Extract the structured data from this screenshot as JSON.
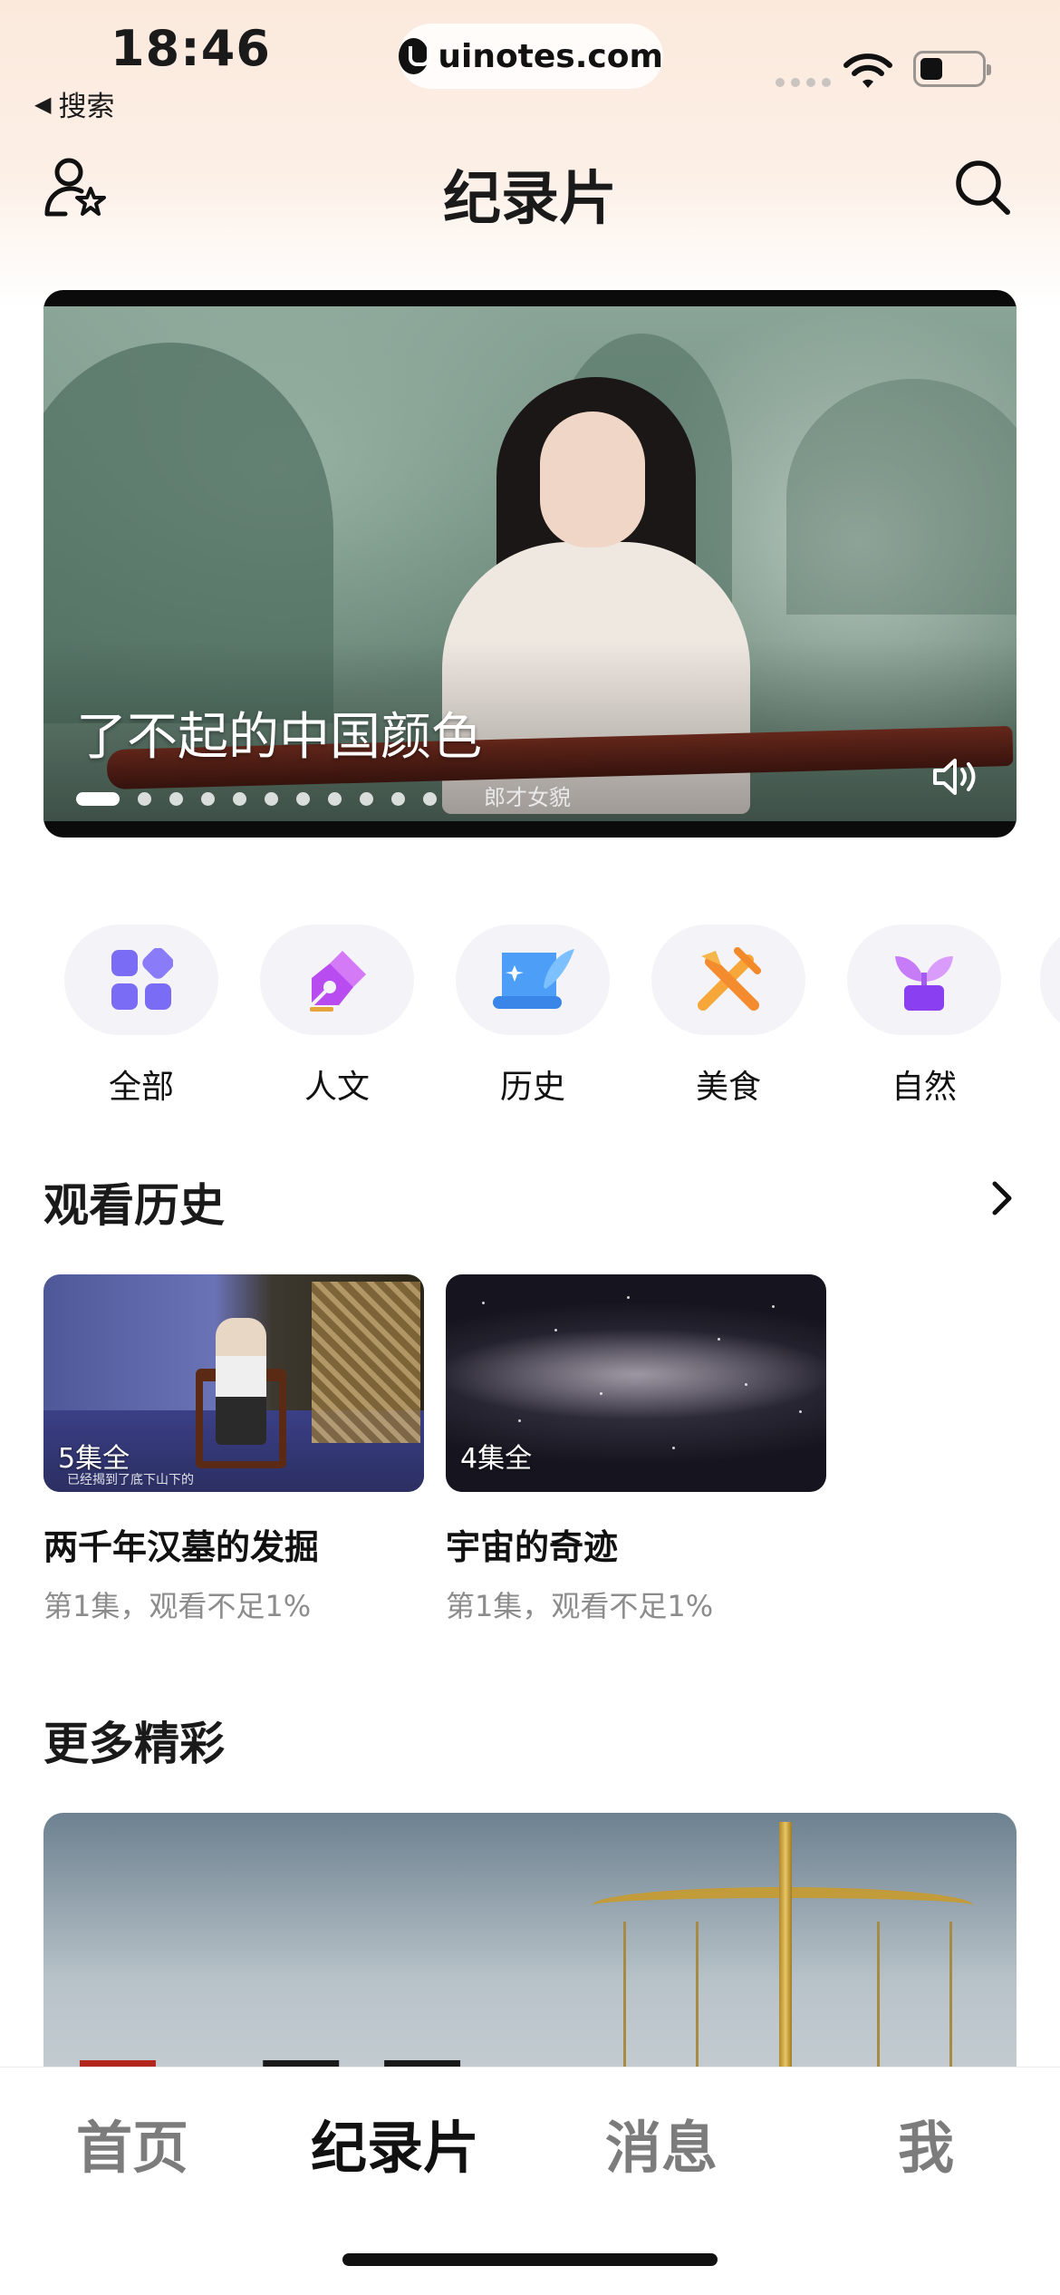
{
  "status_bar": {
    "time": "18:46",
    "back_label": "搜索",
    "back_icon": "triangle-left",
    "url": "uinotes.com"
  },
  "header": {
    "title": "纪录片",
    "left_icon": "profile-star-icon",
    "right_icon": "search-icon"
  },
  "banner": {
    "title": "了不起的中国颜色",
    "subtitle": "郎才女貌",
    "slide_count": 11,
    "active_slide": 0,
    "sound_icon": "speaker-icon"
  },
  "categories": [
    {
      "label": "全部",
      "icon": "grid-icon",
      "color": "#7b6cf6"
    },
    {
      "label": "人文",
      "icon": "pen-icon",
      "color": "#c05ef0"
    },
    {
      "label": "历史",
      "icon": "scroll-icon",
      "color": "#4a9cf5"
    },
    {
      "label": "美食",
      "icon": "utensils-icon",
      "color": "#f59a2f"
    },
    {
      "label": "自然",
      "icon": "plant-icon",
      "color": "#a455f0"
    }
  ],
  "history": {
    "title": "观看历史",
    "more_icon": "chevron-right-icon",
    "items": [
      {
        "title": "两千年汉墓的发掘",
        "episodes": "5集全",
        "progress": "第1集，观看不足1%",
        "caption": "已经揭到了底下山下的"
      },
      {
        "title": "宇宙的奇迹",
        "episodes": "4集全",
        "progress": "第1集，观看不足1%"
      }
    ]
  },
  "more": {
    "title": "更多精彩"
  },
  "tabbar": {
    "tabs": [
      {
        "label": "首页",
        "active": false
      },
      {
        "label": "纪录片",
        "active": true
      },
      {
        "label": "消息",
        "active": false
      },
      {
        "label": "我",
        "active": false
      }
    ]
  }
}
